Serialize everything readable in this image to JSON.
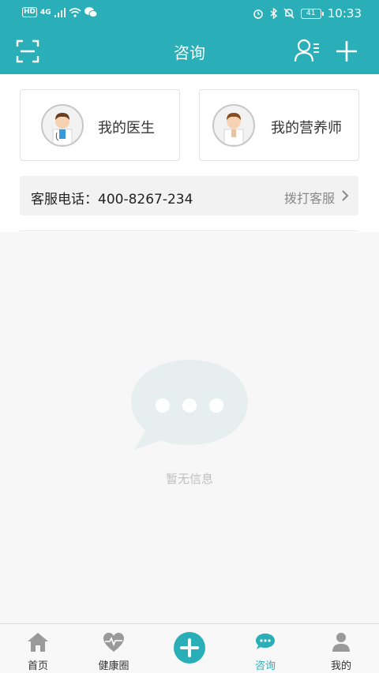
{
  "status_bar": {
    "hd": "HD",
    "network": "4G",
    "battery": "41",
    "time": "10:33"
  },
  "header": {
    "title": "咨询"
  },
  "cards": [
    {
      "label": "我的医生"
    },
    {
      "label": "我的营养师"
    }
  ],
  "service": {
    "label": "客服电话：400-8267-234",
    "action": "拨打客服"
  },
  "empty": {
    "text": "暂无信息"
  },
  "tabs": [
    {
      "label": "首页"
    },
    {
      "label": "健康圈"
    },
    {
      "label": "咨询"
    },
    {
      "label": "我的"
    }
  ],
  "colors": {
    "accent": "#2aafb8",
    "empty_icon": "#e6efee"
  }
}
